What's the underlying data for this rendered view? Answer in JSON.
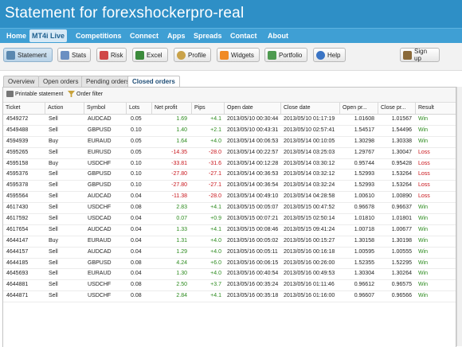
{
  "window": {
    "title": "Statement for forexshockerpro-real"
  },
  "nav": {
    "items": [
      {
        "label": "Home"
      },
      {
        "label": "MT4i Live",
        "active": true
      },
      {
        "label": "Competitions"
      },
      {
        "label": "Connect"
      },
      {
        "label": "Apps"
      },
      {
        "label": "Spreads"
      },
      {
        "label": "Contact"
      },
      {
        "label": "About"
      }
    ]
  },
  "toolbar": {
    "statement": "Statement",
    "stats": "Stats",
    "risk": "Risk",
    "excel": "Excel",
    "profile": "Profile",
    "widgets": "Widgets",
    "portfolio": "Portfolio",
    "help": "Help",
    "signup": "Sign up"
  },
  "tabs": [
    "Overview",
    "Open orders",
    "Pending orders",
    "Closed orders"
  ],
  "subbar": {
    "printable": "Printable statement",
    "filter": "Order filter"
  },
  "table": {
    "headers": [
      "Ticket",
      "Action",
      "Symbol",
      "Lots",
      "Net profit",
      "Pips",
      "Open date",
      "Close date",
      "Open pr...",
      "Close pr...",
      "Result"
    ],
    "rows": [
      [
        "4549272",
        "Sell",
        "AUDCAD",
        "0.05",
        "1.69",
        "+4.1",
        "2013/05/10 00:30:44",
        "2013/05/10 01:17:19",
        "1.01608",
        "1.01567",
        "Win"
      ],
      [
        "4549488",
        "Sell",
        "GBPUSD",
        "0.10",
        "1.40",
        "+2.1",
        "2013/05/10 00:43:31",
        "2013/05/10 02:57:41",
        "1.54517",
        "1.54496",
        "Win"
      ],
      [
        "4594939",
        "Buy",
        "EURAUD",
        "0.05",
        "1.64",
        "+4.0",
        "2013/05/14 00:06:53",
        "2013/05/14 00:10:05",
        "1.30298",
        "1.30338",
        "Win"
      ],
      [
        "4595265",
        "Sell",
        "EURUSD",
        "0.05",
        "-14.35",
        "-28.0",
        "2013/05/14 00:22:57",
        "2013/05/14 03:25:03",
        "1.29767",
        "1.30047",
        "Loss"
      ],
      [
        "4595158",
        "Buy",
        "USDCHF",
        "0.10",
        "-33.81",
        "-31.6",
        "2013/05/14 00:12:28",
        "2013/05/14 03:30:12",
        "0.95744",
        "0.95428",
        "Loss"
      ],
      [
        "4595376",
        "Sell",
        "GBPUSD",
        "0.10",
        "-27.80",
        "-27.1",
        "2013/05/14 00:36:53",
        "2013/05/14 03:32:12",
        "1.52993",
        "1.53264",
        "Loss"
      ],
      [
        "4595378",
        "Sell",
        "GBPUSD",
        "0.10",
        "-27.80",
        "-27.1",
        "2013/05/14 00:36:54",
        "2013/05/14 03:32:24",
        "1.52993",
        "1.53264",
        "Loss"
      ],
      [
        "4595564",
        "Sell",
        "AUDCAD",
        "0.04",
        "-11.38",
        "-28.0",
        "2013/05/14 00:49:10",
        "2013/05/14 04:28:58",
        "1.00610",
        "1.00890",
        "Loss"
      ],
      [
        "4617430",
        "Sell",
        "USDCHF",
        "0.08",
        "2.83",
        "+4.1",
        "2013/05/15 00:05:07",
        "2013/05/15 00:47:52",
        "0.96678",
        "0.96637",
        "Win"
      ],
      [
        "4617592",
        "Sell",
        "USDCAD",
        "0.04",
        "0.07",
        "+0.9",
        "2013/05/15 00:07:21",
        "2013/05/15 02:50:14",
        "1.01810",
        "1.01801",
        "Win"
      ],
      [
        "4617654",
        "Sell",
        "AUDCAD",
        "0.04",
        "1.33",
        "+4.1",
        "2013/05/15 00:08:46",
        "2013/05/15 09:41:24",
        "1.00718",
        "1.00677",
        "Win"
      ],
      [
        "4644147",
        "Buy",
        "EURAUD",
        "0.04",
        "1.31",
        "+4.0",
        "2013/05/16 00:05:02",
        "2013/05/16 00:15:27",
        "1.30158",
        "1.30198",
        "Win"
      ],
      [
        "4644157",
        "Sell",
        "AUDCAD",
        "0.04",
        "1.29",
        "+4.0",
        "2013/05/16 00:05:11",
        "2013/05/16 00:16:18",
        "1.00595",
        "1.00555",
        "Win"
      ],
      [
        "4644185",
        "Sell",
        "GBPUSD",
        "0.08",
        "4.24",
        "+6.0",
        "2013/05/16 00:06:15",
        "2013/05/16 00:26:00",
        "1.52355",
        "1.52295",
        "Win"
      ],
      [
        "4645693",
        "Sell",
        "EURAUD",
        "0.04",
        "1.30",
        "+4.0",
        "2013/05/16 00:40:54",
        "2013/05/16 00:49:53",
        "1.30304",
        "1.30264",
        "Win"
      ],
      [
        "4644881",
        "Sell",
        "USDCHF",
        "0.08",
        "2.50",
        "+3.7",
        "2013/05/16 00:35:24",
        "2013/05/16 01:11:46",
        "0.96612",
        "0.96575",
        "Win"
      ],
      [
        "4644871",
        "Sell",
        "USDCHF",
        "0.08",
        "2.84",
        "+4.1",
        "2013/05/16 00:35:18",
        "2013/05/16 01:16:00",
        "0.96607",
        "0.96566",
        "Win"
      ]
    ]
  },
  "colors": {
    "titlebar": "#2e8fc6",
    "navbar": "#3f9fd4",
    "positive": "#2b8a1d",
    "negative": "#c8151b"
  },
  "icons": [
    "chart-icon",
    "bar-chart-icon",
    "risk-chart-icon",
    "excel-icon",
    "profile-icon",
    "rss-icon",
    "portfolio-icon",
    "info-icon",
    "signup-icon",
    "printer-icon",
    "filter-icon"
  ]
}
